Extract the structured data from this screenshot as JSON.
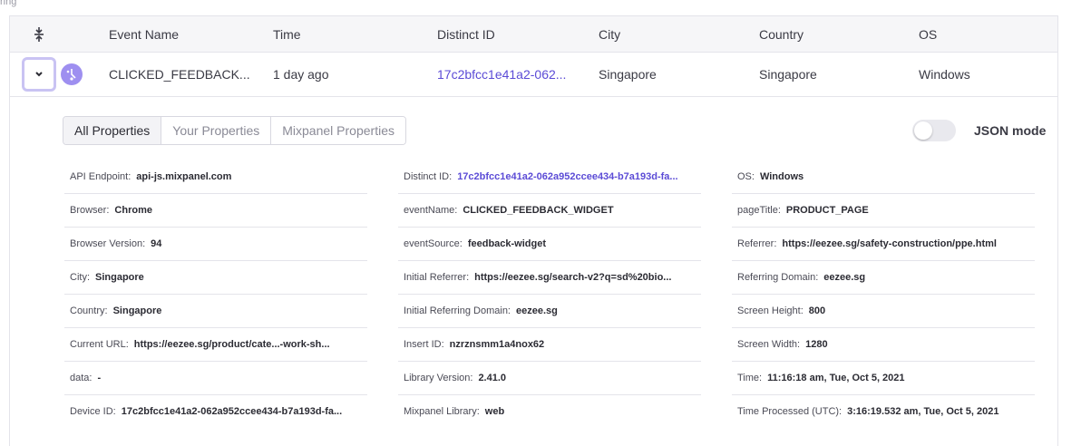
{
  "top_text": "ring",
  "columns": {
    "event_name": "Event Name",
    "time": "Time",
    "distinct_id": "Distinct ID",
    "city": "City",
    "country": "Country",
    "os": "OS"
  },
  "event": {
    "name": "CLICKED_FEEDBACK...",
    "time": "1 day ago",
    "distinct_id": "17c2bfcc1e41a2-062...",
    "city": "Singapore",
    "country": "Singapore",
    "os": "Windows"
  },
  "tabs": [
    "All Properties",
    "Your Properties",
    "Mixpanel Properties"
  ],
  "json_mode": {
    "label": "JSON mode",
    "enabled": false
  },
  "properties": {
    "col1": [
      {
        "k": "API Endpoint:",
        "v": "api-js.mixpanel.com"
      },
      {
        "k": "Browser:",
        "v": "Chrome"
      },
      {
        "k": "Browser Version:",
        "v": "94"
      },
      {
        "k": "City:",
        "v": "Singapore"
      },
      {
        "k": "Country:",
        "v": "Singapore"
      },
      {
        "k": "Current URL:",
        "v": "https://eezee.sg/product/cate...-work-sh..."
      },
      {
        "k": "data:",
        "v": "-"
      },
      {
        "k": "Device ID:",
        "v": "17c2bfcc1e41a2-062a952ccee434-b7a193d-fa..."
      }
    ],
    "col2": [
      {
        "k": "Distinct ID:",
        "v": "17c2bfcc1e41a2-062a952ccee434-b7a193d-fa...",
        "link": true
      },
      {
        "k": "eventName:",
        "v": "CLICKED_FEEDBACK_WIDGET"
      },
      {
        "k": "eventSource:",
        "v": "feedback-widget"
      },
      {
        "k": "Initial Referrer:",
        "v": "https://eezee.sg/search-v2?q=sd%20bio..."
      },
      {
        "k": "Initial Referring Domain:",
        "v": "eezee.sg"
      },
      {
        "k": "Insert ID:",
        "v": "nzrznsmm1a4nox62"
      },
      {
        "k": "Library Version:",
        "v": "2.41.0"
      },
      {
        "k": "Mixpanel Library:",
        "v": "web"
      }
    ],
    "col3": [
      {
        "k": "OS:",
        "v": "Windows"
      },
      {
        "k": "pageTitle:",
        "v": "PRODUCT_PAGE"
      },
      {
        "k": "Referrer:",
        "v": "https://eezee.sg/safety-construction/ppe.html"
      },
      {
        "k": "Referring Domain:",
        "v": "eezee.sg"
      },
      {
        "k": "Screen Height:",
        "v": "800"
      },
      {
        "k": "Screen Width:",
        "v": "1280"
      },
      {
        "k": "Time:",
        "v": "11:16:18 am, Tue, Oct 5, 2021"
      },
      {
        "k": "Time Processed (UTC):",
        "v": "3:16:19.532 am, Tue, Oct 5, 2021"
      }
    ]
  },
  "colors": {
    "accent": "#5b4bd6",
    "accent_light": "#c9c3f3",
    "event_icon": "#9e8ff0"
  },
  "icons": {
    "collapse": "collapse-all-icon",
    "expand": "chevron-down-icon",
    "event": "event-type-icon"
  }
}
